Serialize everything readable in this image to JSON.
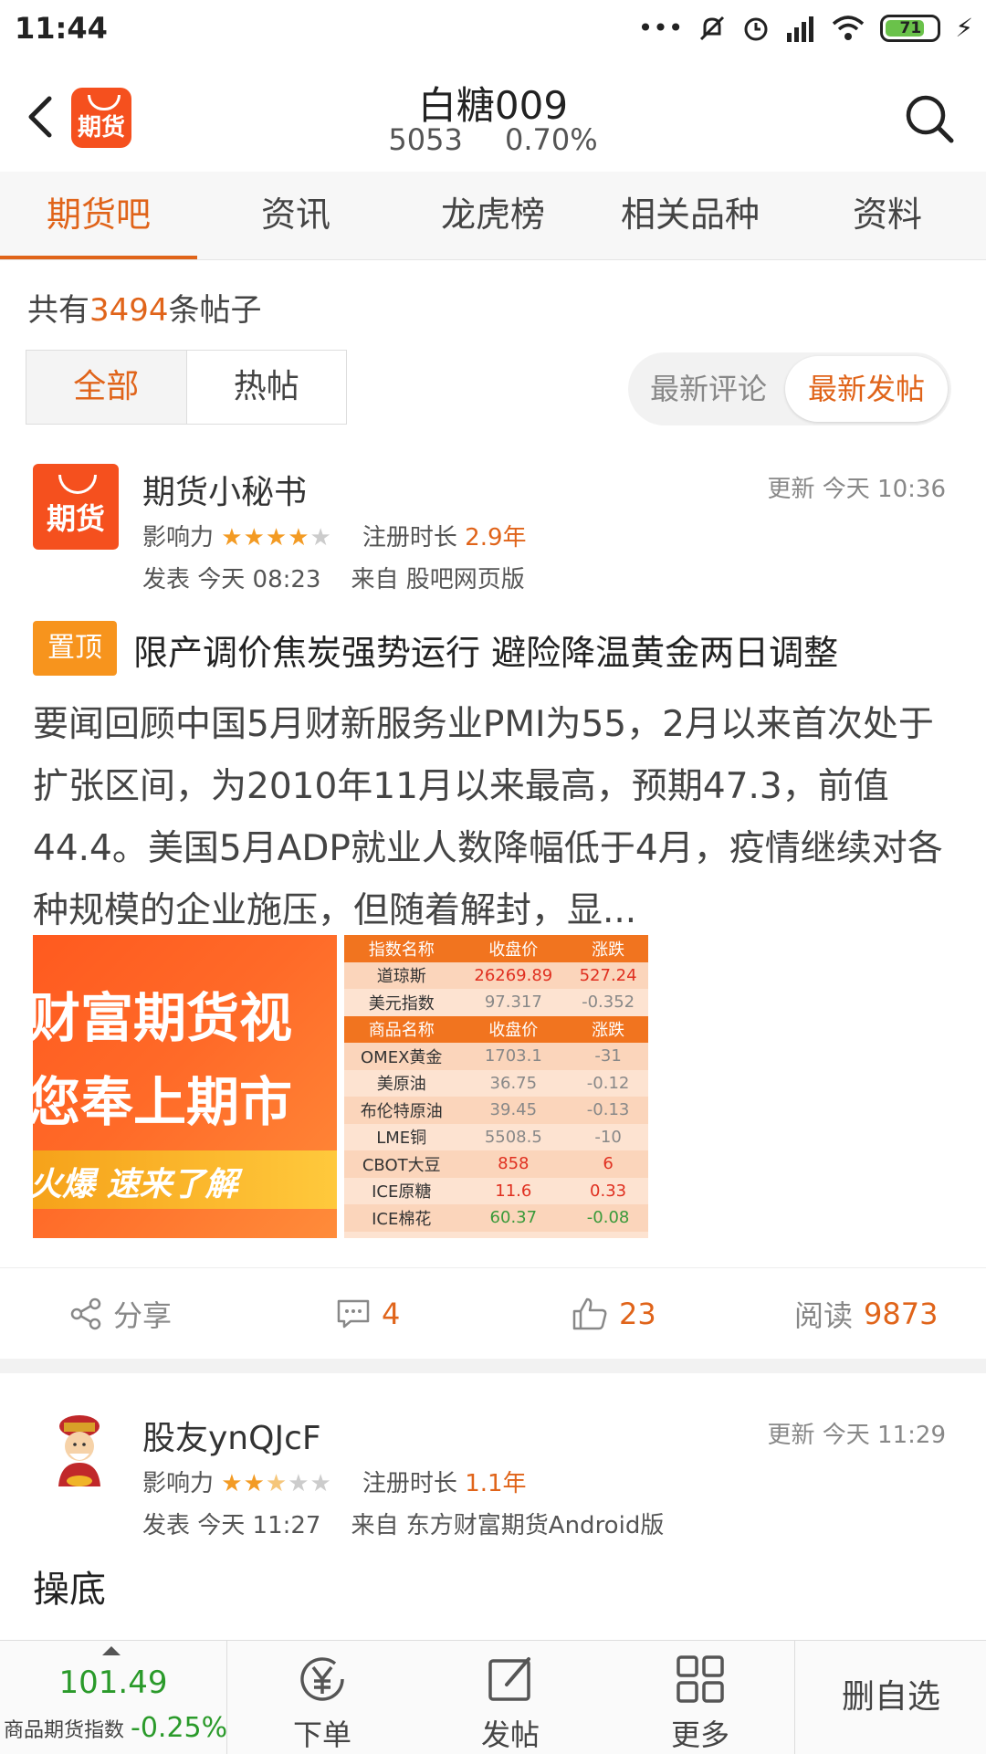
{
  "status_bar": {
    "time": "11:44",
    "battery": "71"
  },
  "header": {
    "title": "白糖009",
    "price": "5053",
    "change": "0.70%",
    "logo_text": "期货"
  },
  "tabs": [
    "期货吧",
    "资讯",
    "龙虎榜",
    "相关品种",
    "资料"
  ],
  "count": {
    "prefix": "共有",
    "number": "3494",
    "suffix": "条帖子"
  },
  "filter": {
    "all": "全部",
    "hot": "热帖"
  },
  "sort": {
    "latest_comment": "最新评论",
    "latest_post": "最新发帖"
  },
  "post1": {
    "avatar_text": "期货",
    "username": "期货小秘书",
    "updated": "更新 今天 10:36",
    "influence_label": "影响力",
    "register_label": "注册时长",
    "register_value": "2.9年",
    "posted": "发表 今天 08:23",
    "source": "来自 股吧网页版",
    "pin_label": "置顶",
    "title": "限产调价焦炭强势运行 避险降温黄金两日调整",
    "body": "要闻回顾中国5月财新服务业PMI为55，2月以来首次处于扩张区间，为2010年11月以来最高，预期47.3，前值44.4。美国5月ADP就业人数降幅低于4月，疫情继续对各种规模的企业施压，但随着解封，显...",
    "image1": {
      "line1": "财富期货视",
      "line2": "您奉上期市",
      "line3": "火爆  速来了解"
    },
    "image2": {
      "header1": [
        "指数名称",
        "收盘价",
        "涨跌"
      ],
      "rows1": [
        [
          "道琼斯",
          "26269.89",
          "527.24"
        ],
        [
          "美元指数",
          "97.317",
          "-0.352"
        ]
      ],
      "header2": [
        "商品名称",
        "收盘价",
        "涨跌"
      ],
      "rows2": [
        [
          "OMEX黄金",
          "1703.1",
          "-31"
        ],
        [
          "美原油",
          "36.75",
          "-0.12"
        ],
        [
          "布伦特原油",
          "39.45",
          "-0.13"
        ],
        [
          "LME铜",
          "5508.5",
          "-10"
        ],
        [
          "CBOT大豆",
          "858",
          "6"
        ],
        [
          "ICE原糖",
          "11.6",
          "0.33"
        ],
        [
          "ICE棉花",
          "60.37",
          "-0.08"
        ]
      ]
    },
    "share_label": "分享",
    "comments": "4",
    "likes": "23",
    "read_label": "阅读",
    "reads": "9873"
  },
  "post2": {
    "username": "股友ynQJcF",
    "updated": "更新 今天 11:29",
    "influence_label": "影响力",
    "register_label": "注册时长",
    "register_value": "1.1年",
    "posted": "发表 今天 11:27",
    "source": "来自 东方财富期货Android版",
    "text": "操底"
  },
  "bottom_bar": {
    "index_value": "101.49",
    "index_label": "商品期货指数",
    "index_change": "-0.25%",
    "order": "下单",
    "post": "发帖",
    "more": "更多",
    "remove": "删自选"
  },
  "colors": {
    "accent": "#e0641a",
    "up": "#e03020",
    "down": "#2a9a2a"
  }
}
